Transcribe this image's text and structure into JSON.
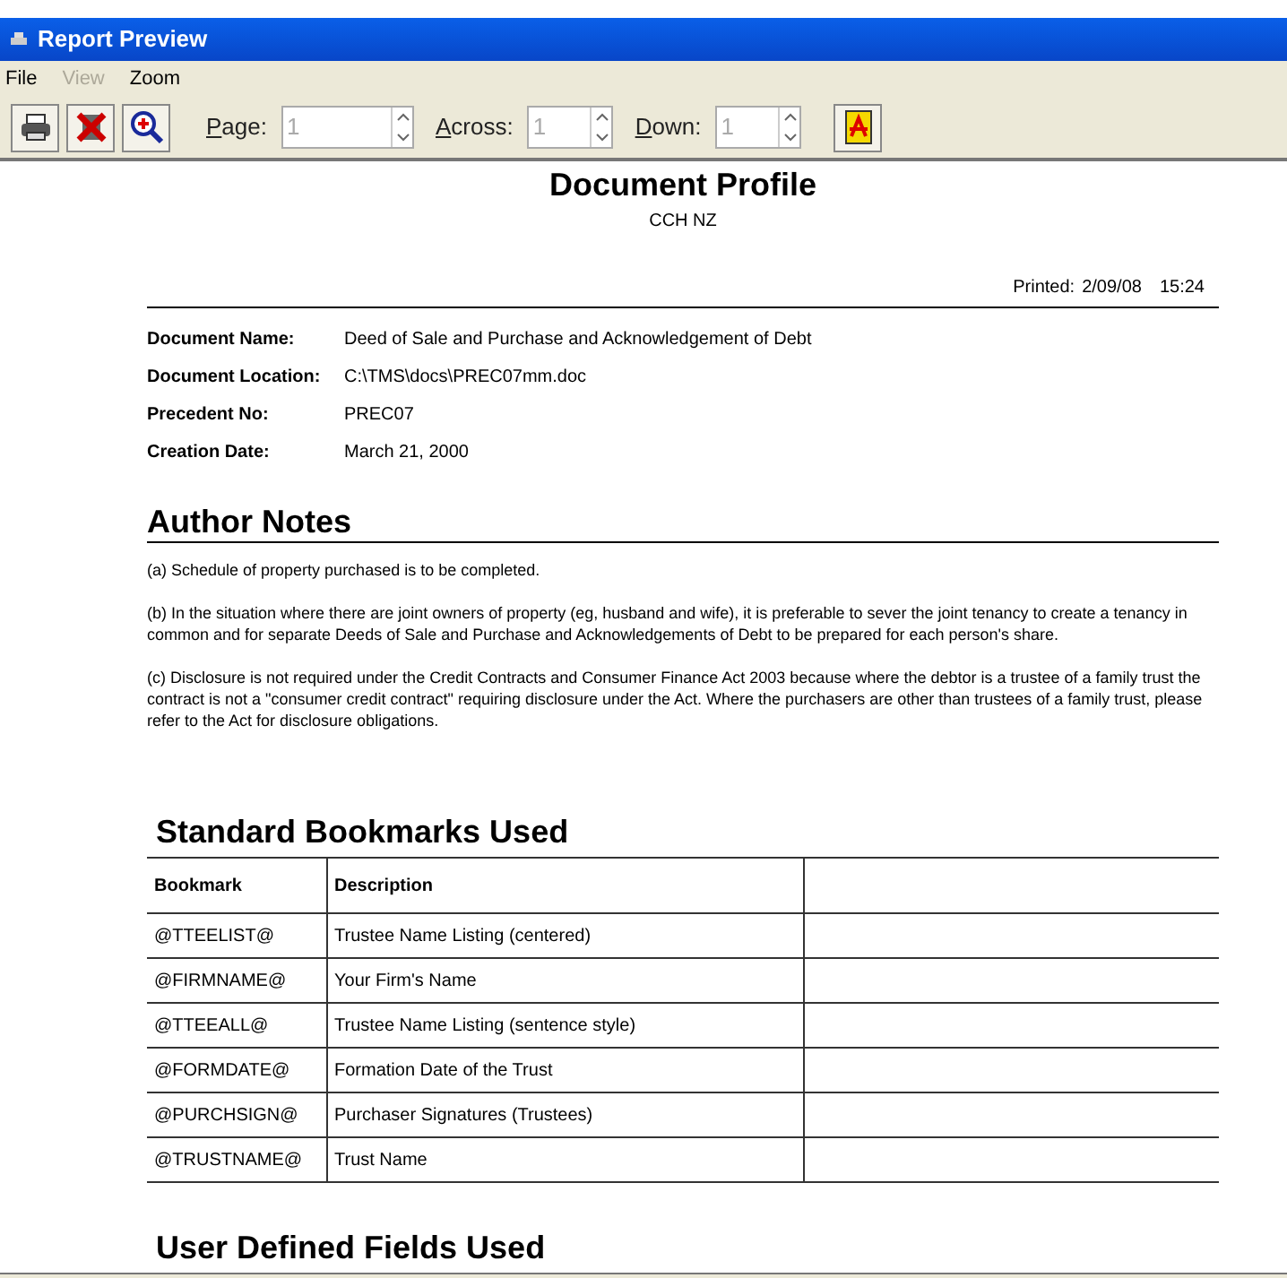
{
  "window": {
    "title": "Report Preview"
  },
  "menu": [
    {
      "label": "File",
      "disabled": false
    },
    {
      "label": "View",
      "disabled": true
    },
    {
      "label": "Zoom",
      "disabled": false
    }
  ],
  "toolbar": {
    "spinners": [
      {
        "label": "Page:",
        "value": "1",
        "disabled": true
      },
      {
        "label": "Across:",
        "value": "1",
        "disabled": true
      },
      {
        "label": "Down:",
        "value": "1",
        "disabled": true
      }
    ]
  },
  "document": {
    "title": "Document Profile",
    "subtitle": "CCH NZ",
    "printed_label": "Printed:",
    "printed_date": "2/09/08",
    "printed_time": "15:24",
    "fields": [
      {
        "label": "Document Name:",
        "value": "Deed of Sale and Purchase and Acknowledgement of Debt"
      },
      {
        "label": "Document Location:",
        "value": "C:\\TMS\\docs\\PREC07mm.doc"
      },
      {
        "label": "Precedent No:",
        "value": "PREC07"
      },
      {
        "label": "Creation Date:",
        "value": "March 21, 2000"
      }
    ],
    "author_notes": {
      "heading": "Author Notes",
      "paragraphs": [
        "(a)  Schedule of property purchased is to be completed.",
        "(b)  In the situation where there are joint owners of property (eg, husband and wife), it is preferable to sever the joint tenancy to create a tenancy in common and for separate Deeds of Sale and Purchase and Acknowledgements of Debt to be prepared for each person's share.",
        "(c)  Disclosure is not required under the Credit Contracts and Consumer Finance Act 2003 because where the debtor is a trustee of a family trust the contract is not a \"consumer credit contract\" requiring disclosure under the Act. Where the purchasers are other than trustees of a family trust, please refer to the Act for disclosure obligations."
      ]
    },
    "bookmarks": {
      "heading": "Standard Bookmarks Used",
      "columns": [
        "Bookmark",
        "Description"
      ],
      "rows": [
        [
          "@TTEELIST@",
          "Trustee Name Listing (centered)"
        ],
        [
          "@FIRMNAME@",
          "Your Firm's Name"
        ],
        [
          "@TTEEALL@",
          "Trustee Name Listing (sentence style)"
        ],
        [
          "@FORMDATE@",
          "Formation Date of the Trust"
        ],
        [
          "@PURCHSIGN@",
          "Purchaser Signatures (Trustees)"
        ],
        [
          "@TRUSTNAME@",
          "Trust Name"
        ]
      ]
    },
    "user_fields": {
      "heading": "User Defined Fields Used"
    }
  }
}
